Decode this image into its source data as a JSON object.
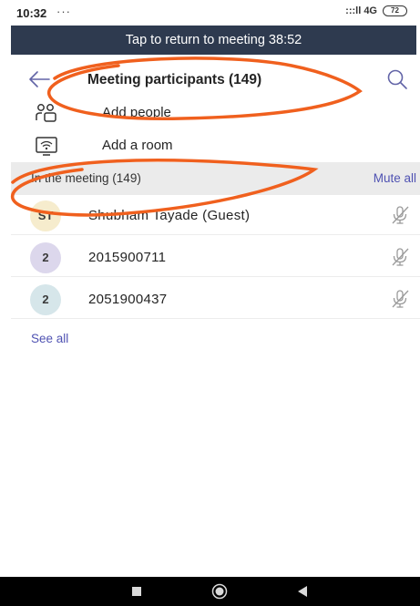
{
  "status_bar": {
    "time": "10:32",
    "dots": "···",
    "signal": ":::ll 4G",
    "battery": "72"
  },
  "return_bar": {
    "text": "Tap to return to meeting 38:52"
  },
  "header": {
    "title": "Meeting participants (149)"
  },
  "actions": [
    {
      "label": "Add people",
      "icon": "add-people-icon"
    },
    {
      "label": "Add a room",
      "icon": "room-cast-icon"
    }
  ],
  "section": {
    "title": "In the meeting (149)",
    "mute_all_label": "Mute all"
  },
  "participants": [
    {
      "initials": "ST",
      "name": "Shubham Tayade (Guest)",
      "avatar_color": "#f6eccd",
      "muted": true
    },
    {
      "initials": "2",
      "name": "2015900711",
      "avatar_color": "#dcd7ec",
      "muted": true
    },
    {
      "initials": "2",
      "name": "2051900437",
      "avatar_color": "#d6e6ea",
      "muted": true
    }
  ],
  "see_all_label": "See all",
  "colors": {
    "accent": "#4f52b2",
    "return_bar": "#2e3a4f",
    "annotation_ink": "#f0601e"
  }
}
